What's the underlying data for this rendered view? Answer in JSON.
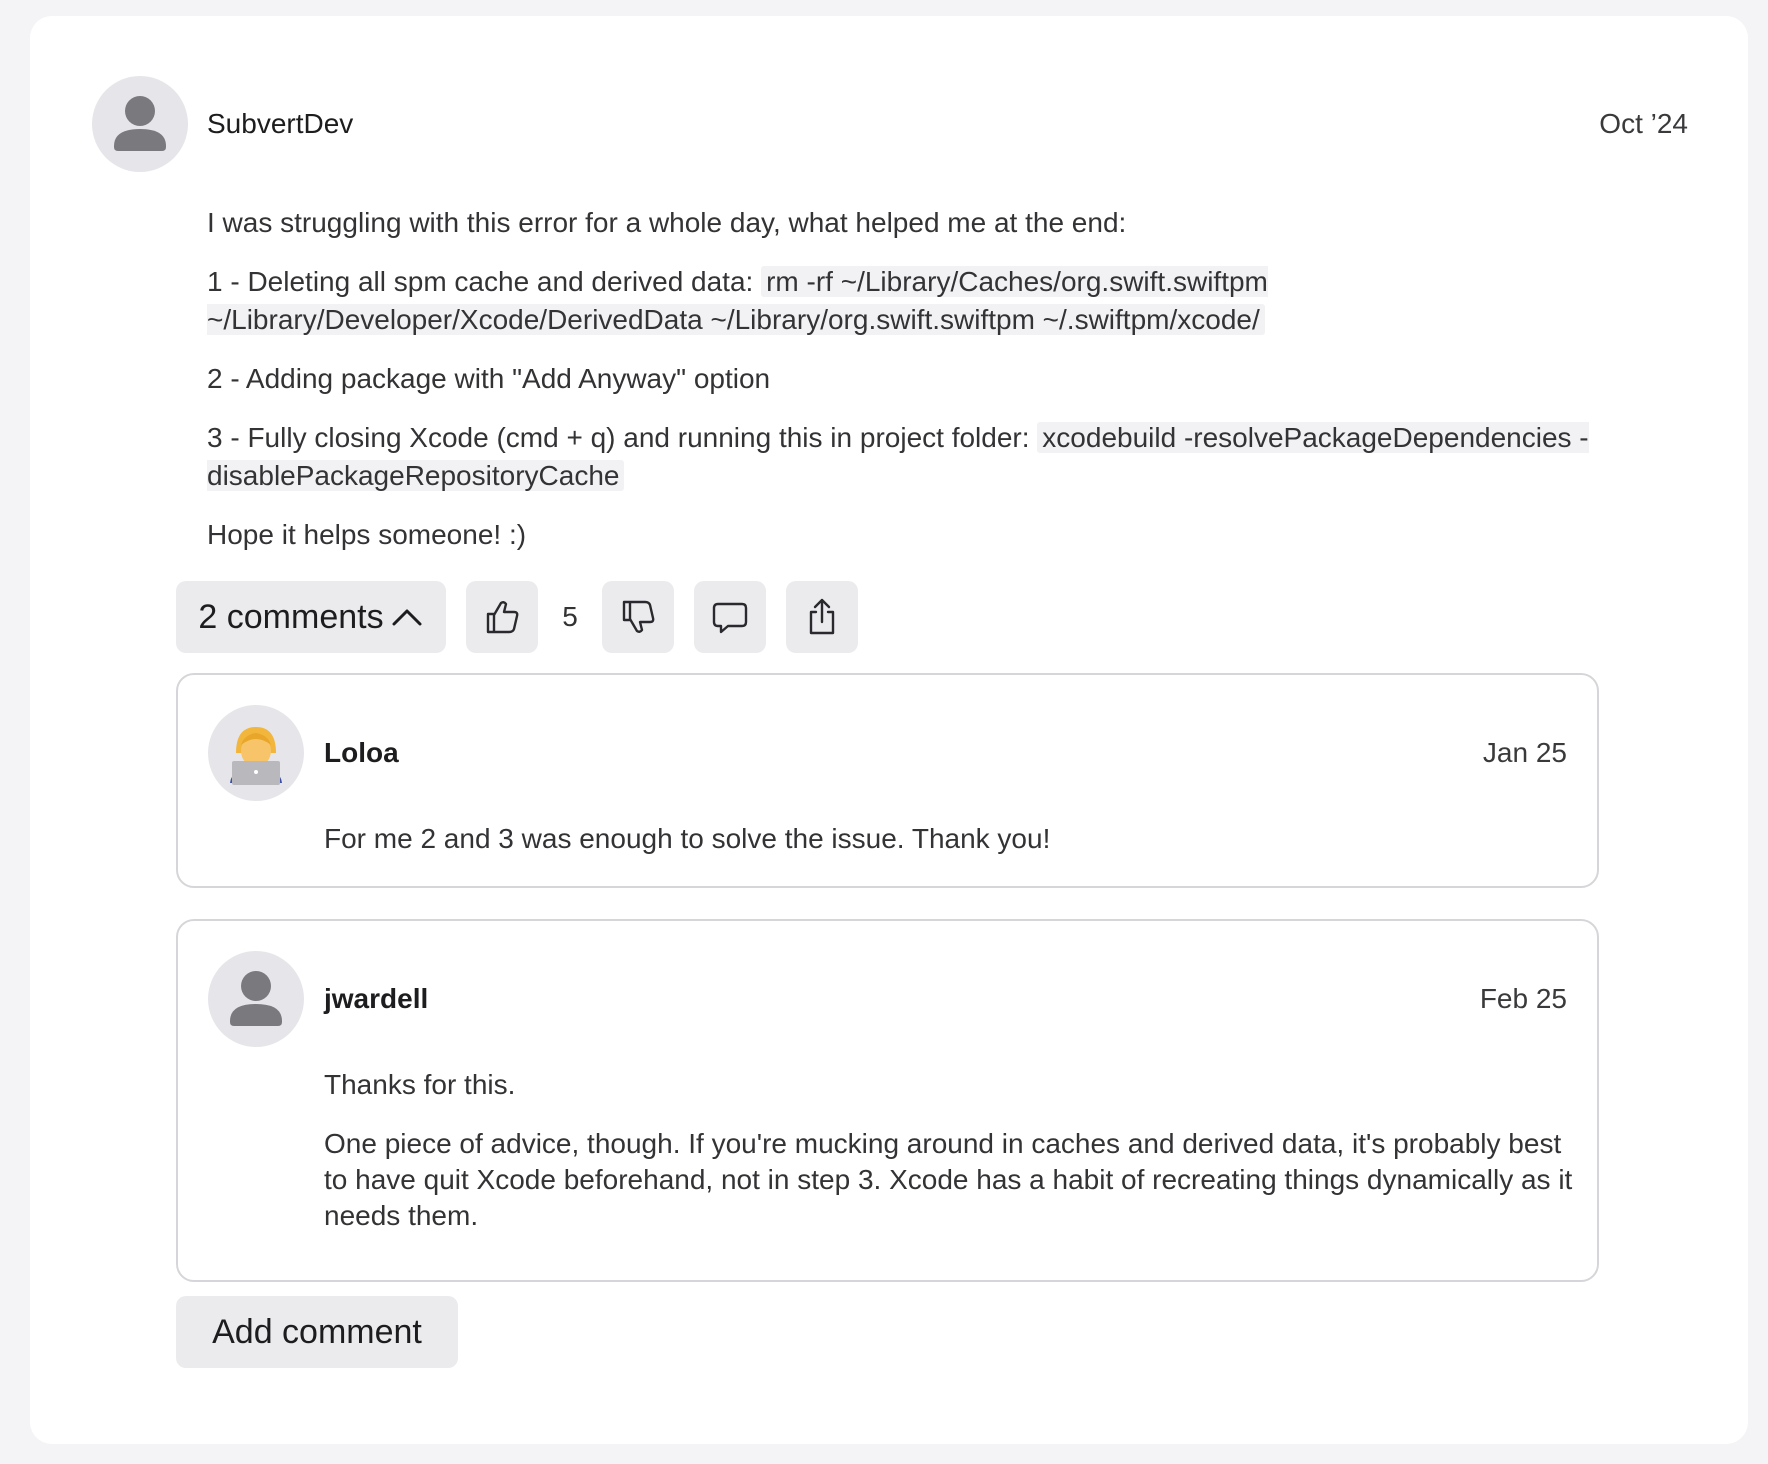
{
  "post": {
    "author": "SubvertDev",
    "date": "Oct ’24",
    "paragraphs": {
      "intro": "I was struggling with this error for a whole day, what helped me at the end:",
      "step1_text": "1 - Deleting all spm cache and derived data: ",
      "step1_code": "rm -rf ~/Library/Caches/org.swift.swiftpm ~/Library/Developer/Xcode/DerivedData ~/Library/org.swift.swiftpm ~/.swiftpm/xcode/",
      "step2": "2 - Adding package with \"Add Anyway\" option",
      "step3_text": "3 - Fully closing Xcode (cmd + q) and running this in project folder: ",
      "step3_code": "xcodebuild -resolvePackageDependencies -disablePackageRepositoryCache",
      "outro": "Hope it helps someone! :)"
    }
  },
  "actions": {
    "comments_label": "2 comments",
    "comments_icon": "chevron-up-icon",
    "vote_count": "5",
    "icons": [
      "thumbs-up-icon",
      "thumbs-down-icon",
      "comment-icon",
      "share-icon"
    ]
  },
  "comments": [
    {
      "author": "Loloa",
      "date": "Jan 25",
      "avatar": "technologist-emoji",
      "paragraphs": [
        "For me 2 and 3 was enough to solve the issue. Thank you!"
      ]
    },
    {
      "author": "jwardell",
      "date": "Feb 25",
      "avatar": "default-person-icon",
      "paragraphs": [
        "Thanks for this.",
        "One piece of advice, though. If you're mucking around in caches and derived data, it's probably best to have quit Xcode beforehand, not in step 3. Xcode has a habit of recreating things dynamically as it needs them."
      ]
    }
  ],
  "add_comment_label": "Add comment"
}
